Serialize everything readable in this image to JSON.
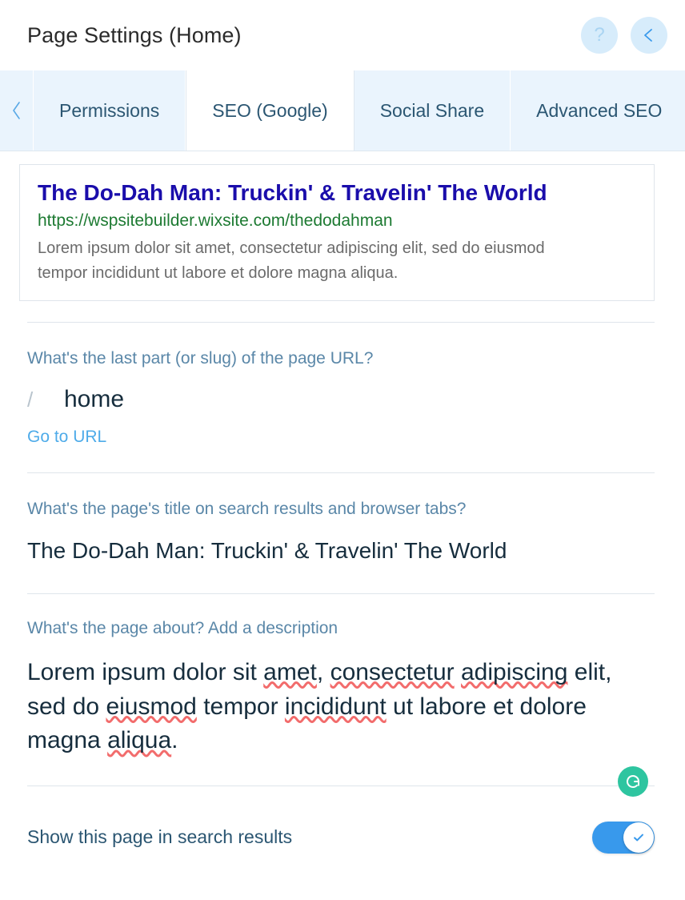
{
  "header": {
    "title": "Page Settings (Home)",
    "help_icon": "question-mark-icon",
    "back_icon": "chevron-left-icon"
  },
  "tabs": {
    "scroll_left_icon": "chevron-left-icon",
    "items": [
      {
        "label": "Permissions",
        "active": false
      },
      {
        "label": "SEO (Google)",
        "active": true
      },
      {
        "label": "Social Share",
        "active": false
      },
      {
        "label": "Advanced SEO",
        "active": false
      }
    ]
  },
  "preview": {
    "title": "The Do-Dah Man: Truckin' & Travelin' The World",
    "url": "https://wspsitebuilder.wixsite.com/thedodahman",
    "description": "Lorem ipsum dolor sit amet, consectetur adipiscing elit, sed do eiusmod tempor incididunt ut labore et dolore magna aliqua."
  },
  "slug_section": {
    "label": "What's the last part (or slug) of the page URL?",
    "prefix": "/",
    "value": "home",
    "placeholder": "home",
    "go_to_url_label": "Go to URL"
  },
  "title_section": {
    "label": "What's the page's title on search results and browser tabs?",
    "value": "The Do-Dah Man: Truckin' & Travelin' The World",
    "placeholder": "Add a title"
  },
  "description_section": {
    "label": "What's the page about? Add a description",
    "value": "Lorem ipsum dolor sit amet, consectetur adipiscing elit, sed do eiusmod tempor incididunt ut labore et dolore magna aliqua.",
    "placeholder": "Add a description",
    "spellcheck_words": [
      "amet,",
      "consectetur",
      "adipiscing",
      "eiusmod",
      "incididunt",
      "aliqua"
    ],
    "grammarly_icon": "grammarly-icon"
  },
  "search_visibility": {
    "label": "Show this page in search results",
    "enabled": true,
    "toggle_icon": "check-icon"
  },
  "colors": {
    "accent": "#3899ec",
    "tab_bar_bg": "#eaf4fd",
    "tab_text": "#2b5672",
    "label_text": "#5a87a8",
    "link": "#4eabe9",
    "preview_title": "#1a0dab",
    "preview_url": "#1d7a32",
    "preview_desc": "#6b6b6b",
    "input_text": "#162d3d",
    "divider": "#dfe5eb",
    "grammarly_green": "#2ec5a0",
    "spellcheck_red": "#f26c6c"
  }
}
